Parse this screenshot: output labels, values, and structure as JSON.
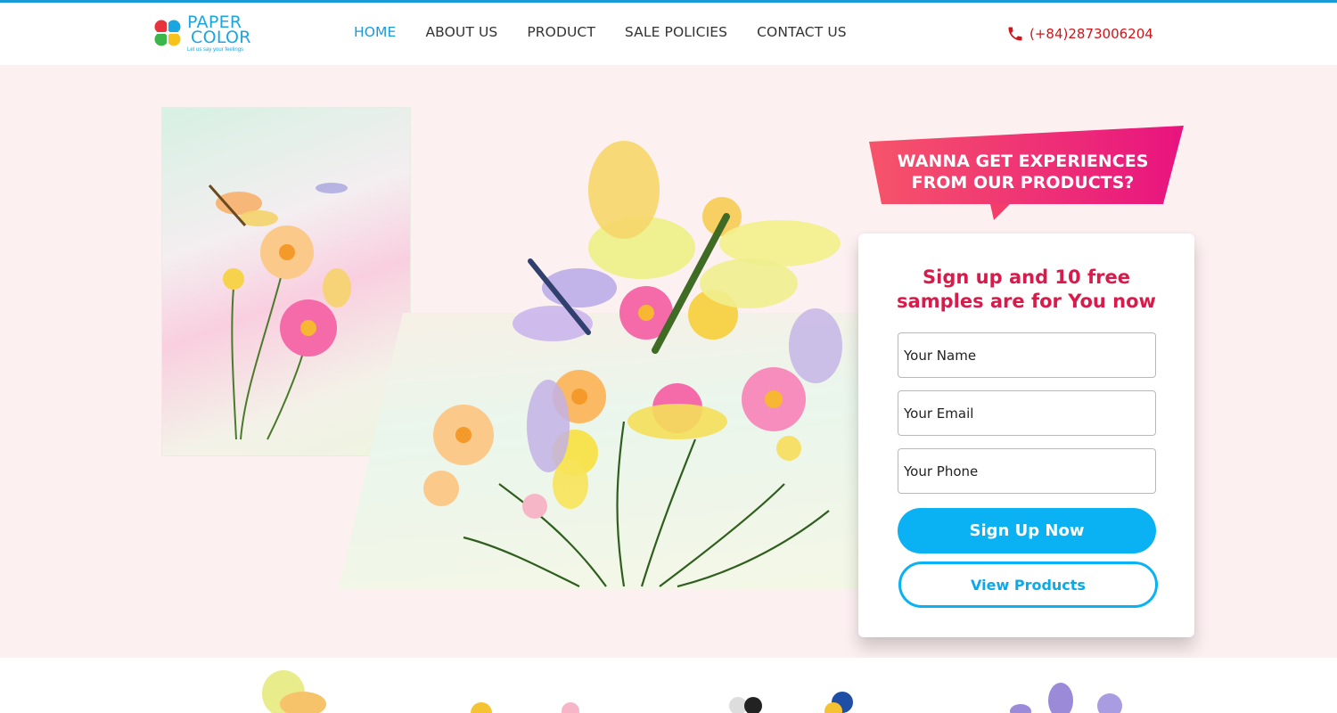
{
  "brand": {
    "line1": "PAPER",
    "line2": "COLOR",
    "tagline": "Let us say your feelings",
    "colors": {
      "red": "#e8323c",
      "blue": "#1aa6e0",
      "green": "#3cb54a",
      "yellow": "#f7c21b"
    }
  },
  "nav": {
    "items": [
      {
        "label": "HOME",
        "active": true
      },
      {
        "label": "ABOUT US",
        "active": false
      },
      {
        "label": "PRODUCT",
        "active": false
      },
      {
        "label": "SALE POLICIES",
        "active": false
      },
      {
        "label": "CONTACT US",
        "active": false
      }
    ]
  },
  "header": {
    "phone": "(+84)2873006204",
    "phone_icon": "phone-icon"
  },
  "hero": {
    "banner_line1": "WANNA GET EXPERIENCES",
    "banner_line2": "FROM OUR PRODUCTS?",
    "form": {
      "title_line1": "Sign up and 10 free",
      "title_line2": "samples are for You now",
      "name_placeholder": "Your Name",
      "email_placeholder": "Your Email",
      "phone_placeholder": "Your Phone",
      "signup_label": "Sign Up Now",
      "view_label": "View Products"
    }
  },
  "theme": {
    "accent": "#0bb2f3",
    "title_red": "#d81b4a",
    "banner_from": "#f6546a",
    "banner_to": "#e8137f",
    "hero_bg": "#fdf0f1"
  }
}
